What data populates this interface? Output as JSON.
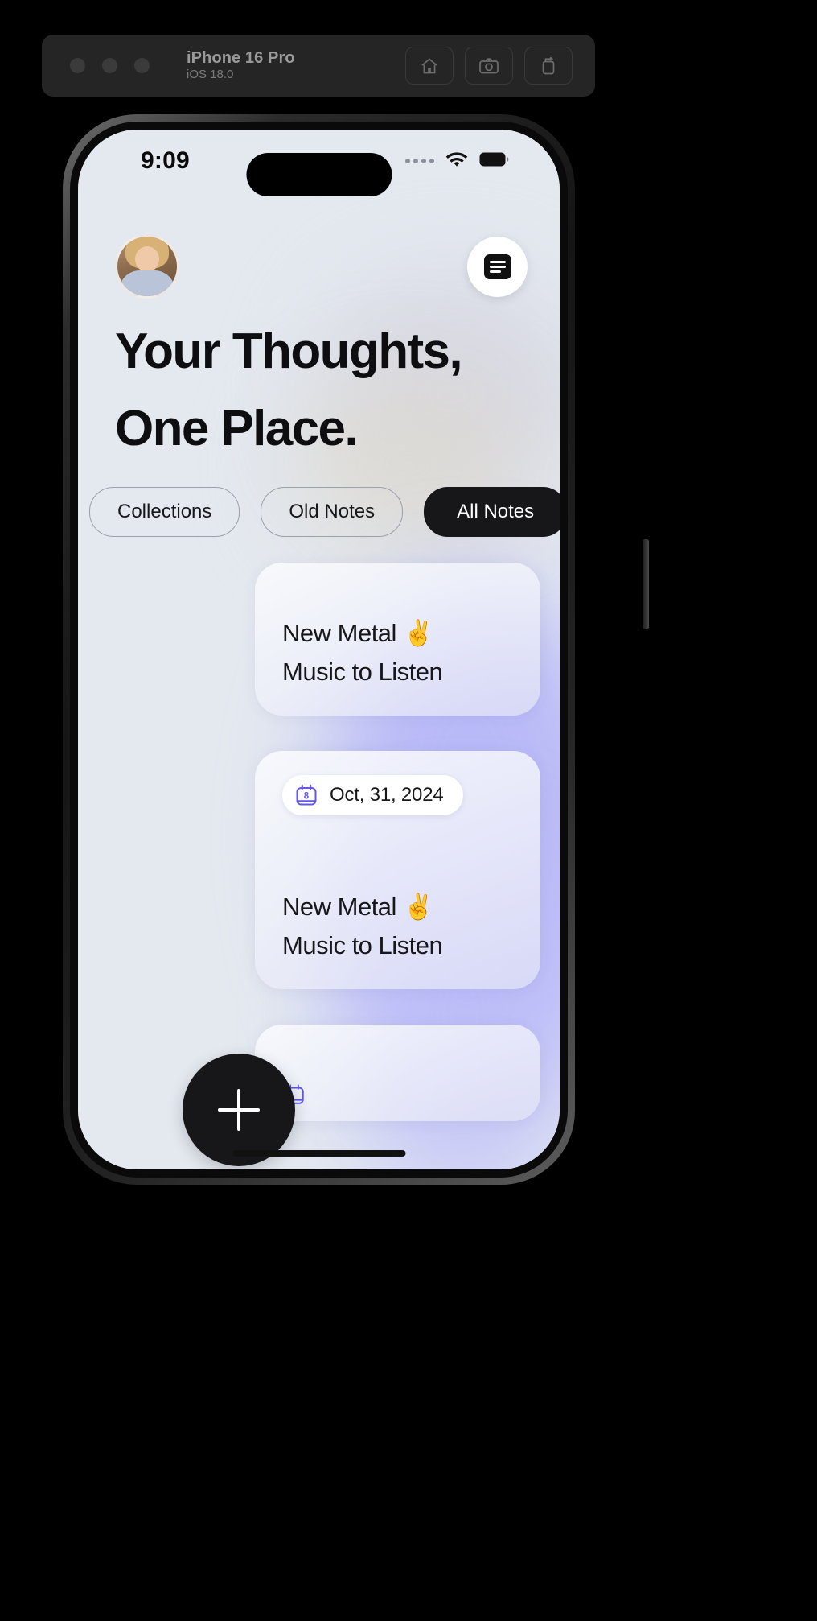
{
  "simulator": {
    "device_name": "iPhone 16 Pro",
    "os_version": "iOS 18.0",
    "window_controls": [
      "close",
      "minimize",
      "zoom"
    ],
    "actions": [
      {
        "name": "home-icon",
        "label": "Home"
      },
      {
        "name": "screenshot-icon",
        "label": "Screenshot"
      },
      {
        "name": "rotate-icon",
        "label": "Rotate"
      }
    ]
  },
  "status_bar": {
    "time": "9:09",
    "cellular": "signal-dots",
    "wifi": "wifi-icon",
    "battery": "battery-icon"
  },
  "app": {
    "avatar_alt": "User profile photo",
    "menu_label": "Menu",
    "headline_line1": "Your Thoughts,",
    "headline_line2": "One Place.",
    "tabs": [
      {
        "label": "Collections",
        "active": false
      },
      {
        "label": "Old Notes",
        "active": false
      },
      {
        "label": "All Notes",
        "active": true
      }
    ],
    "cards": [
      {
        "title_line1": "New Metal ✌️",
        "title_line2": "Music to Listen",
        "date": null
      },
      {
        "title_line1": "New Metal ✌️",
        "title_line2": "Music to Listen",
        "date": "Oct, 31, 2024"
      },
      {
        "title_line1": "",
        "title_line2": "",
        "date": ""
      }
    ],
    "fab_label": "Add note",
    "calendar_icon_day": "8"
  },
  "colors": {
    "accent": "#6257e8",
    "active_pill_bg": "#17171a",
    "app_bg": "#e4e9f0",
    "text": "#17171a"
  }
}
